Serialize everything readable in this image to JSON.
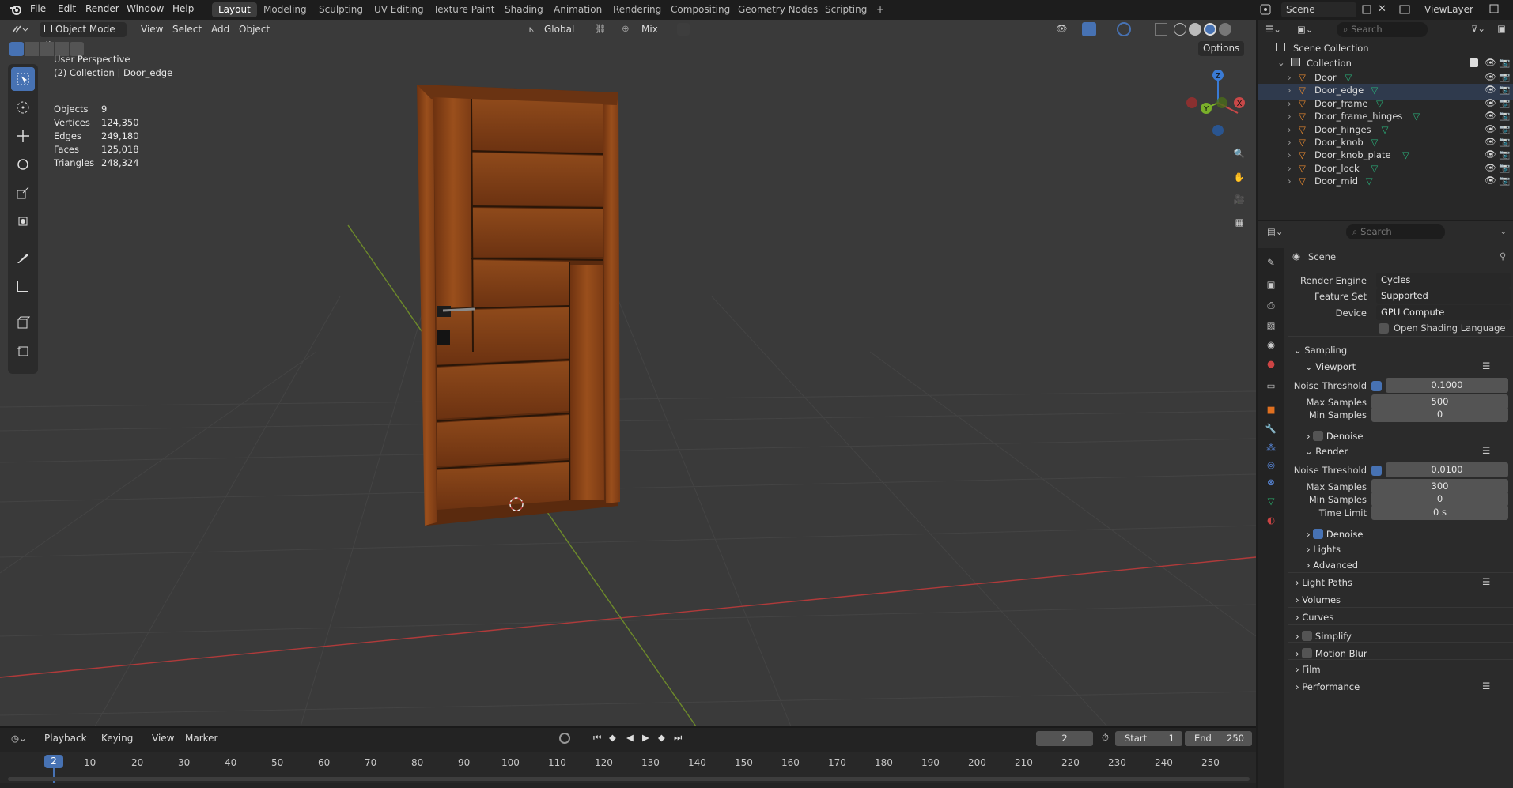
{
  "topbar": {
    "menus": [
      "File",
      "Edit",
      "Render",
      "Window",
      "Help"
    ],
    "workspaces": [
      "Layout",
      "Modeling",
      "Sculpting",
      "UV Editing",
      "Texture Paint",
      "Shading",
      "Animation",
      "Rendering",
      "Compositing",
      "Geometry Nodes",
      "Scripting"
    ],
    "add_tab": "+",
    "scene": "Scene",
    "view_layer": "ViewLayer"
  },
  "viewport": {
    "mode": "Object Mode",
    "menus": [
      "View",
      "Select",
      "Add",
      "Object"
    ],
    "orientation": "Global",
    "pivot": "Mix",
    "options": "Options",
    "perspective": "User Perspective",
    "active": "(2) Collection | Door_edge",
    "stats": [
      {
        "label": "Objects",
        "value": "9"
      },
      {
        "label": "Vertices",
        "value": "124,350"
      },
      {
        "label": "Edges",
        "value": "249,180"
      },
      {
        "label": "Faces",
        "value": "125,018"
      },
      {
        "label": "Triangles",
        "value": "248,324"
      }
    ],
    "gizmo": {
      "z": "Z",
      "y": "Y",
      "x": "X"
    }
  },
  "timeline": {
    "menus": [
      "Playback",
      "Keying",
      "View",
      "Marker"
    ],
    "current_frame": "2",
    "start_label": "Start",
    "start": "1",
    "end_label": "End",
    "end": "250",
    "ticks": [
      "10",
      "20",
      "30",
      "40",
      "50",
      "60",
      "70",
      "80",
      "90",
      "100",
      "110",
      "120",
      "130",
      "140",
      "150",
      "160",
      "170",
      "180",
      "190",
      "200",
      "210",
      "220",
      "230",
      "240",
      "250"
    ]
  },
  "outliner": {
    "search_placeholder": "Search",
    "root": "Scene Collection",
    "collection": "Collection",
    "items": [
      "Door",
      "Door_edge",
      "Door_frame",
      "Door_frame_hinges",
      "Door_hinges",
      "Door_knob",
      "Door_knob_plate",
      "Door_lock",
      "Door_mid"
    ]
  },
  "properties": {
    "search_placeholder": "Search",
    "context": "Scene",
    "render_engine_label": "Render Engine",
    "render_engine": "Cycles",
    "feature_set_label": "Feature Set",
    "feature_set": "Supported",
    "device_label": "Device",
    "device": "GPU Compute",
    "osl": "Open Shading Language",
    "sampling": "Sampling",
    "viewport": "Viewport",
    "noise_threshold_label": "Noise Threshold",
    "vp_noise": "0.1000",
    "max_samples_label": "Max Samples",
    "vp_max": "500",
    "min_samples_label": "Min Samples",
    "vp_min": "0",
    "denoise": "Denoise",
    "render": "Render",
    "r_noise": "0.0100",
    "r_max": "300",
    "r_min": "0",
    "time_limit_label": "Time Limit",
    "time_limit": "0 s",
    "lights": "Lights",
    "advanced": "Advanced",
    "light_paths": "Light Paths",
    "volumes": "Volumes",
    "curves": "Curves",
    "simplify": "Simplify",
    "motion_blur": "Motion Blur",
    "film": "Film",
    "performance": "Performance"
  },
  "colors": {
    "accent": "#4772b3",
    "header": "#1d1d1d",
    "viewport": "#3a3a3a",
    "door": "#8a4318"
  }
}
